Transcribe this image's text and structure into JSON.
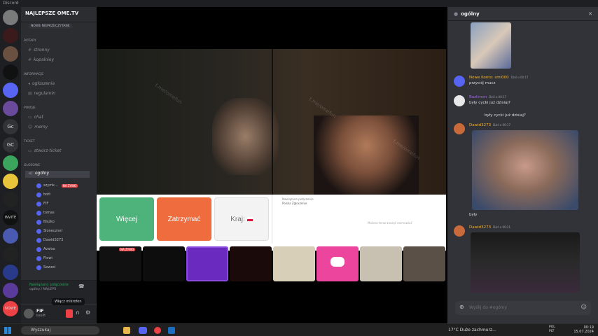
{
  "app": {
    "title": "Discord"
  },
  "servers": [
    "Gc",
    "GC",
    "INVITE",
    "NOWE"
  ],
  "guild": {
    "name": "NAJLEPSZE OME.TV",
    "banner": "NOWE NIEPRZECZYTANE",
    "categories": [
      {
        "label": "ROTARY",
        "channels": [
          "stronny",
          "kopalnioy"
        ]
      },
      {
        "label": "INFORMACJE",
        "channels": [
          "ogłoszenia",
          "regulamin"
        ]
      },
      {
        "label": "POKOJE",
        "channels": [
          "chat",
          "memy"
        ]
      },
      {
        "label": "TICKET",
        "channels": [
          "stwórz-ticket"
        ]
      },
      {
        "label": "GŁOSOWE",
        "channels": [
          "ogólny"
        ]
      }
    ],
    "voice_users": [
      {
        "name": "szymk...",
        "live": "NA ŻYWO"
      },
      {
        "name": "bott"
      },
      {
        "name": "FIF"
      },
      {
        "name": "tomas"
      },
      {
        "name": "Biszko"
      },
      {
        "name": "Slonecznel"
      },
      {
        "name": "Dawid3273"
      },
      {
        "name": "Avaloo"
      },
      {
        "name": "Flowi"
      },
      {
        "name": "Seweci"
      }
    ]
  },
  "voice_status": {
    "title": "Nawiązano połączenie",
    "subtitle": "ogólny / NAJLEPS"
  },
  "user": {
    "name": "FIF",
    "status": "babift"
  },
  "tooltip": "Włącz mikrofon",
  "omegle": {
    "buttons": [
      "Więcej",
      "Zatrzymać",
      "Kraj:"
    ],
    "chat_notice": "Nawiązano połączenie",
    "chat_sub": "Polska Zgłoszenie",
    "chat_hint": "Możesz teraz zacząć rozmawiać",
    "watermark": "t.me/omefun",
    "live_badge": "NA ŻYWO"
  },
  "thread": {
    "title": "ogólny",
    "messages": [
      {
        "name": "Nowe Konto: sml000",
        "time": "Dziś o 00:17",
        "text": "przyciśj mucz"
      },
      {
        "name": "Bazlimon",
        "time": "Dziś o 00:17",
        "text": "były cycki już dzisiaj?"
      },
      {
        "name": "Dawid3273",
        "time": "Dziś o 00:17",
        "text": "były cycki już dzisiaj?"
      },
      {
        "name": "",
        "time": "",
        "text": "były"
      },
      {
        "name": "Dawid3273",
        "time": "Dziś o 00:21",
        "text": ""
      }
    ],
    "input_placeholder": "Wyślij do #ogólny"
  },
  "taskbar": {
    "search": "Wyszukaj",
    "weather": "17°C  Duże zachmurz...",
    "time": "00:19",
    "date": "15.07.2024",
    "lang": "POL\nPLT"
  },
  "colors": {
    "accent": "#5865f2",
    "more": "#4eb37b",
    "stop": "#ef6c3e",
    "live": "#ed4245"
  }
}
